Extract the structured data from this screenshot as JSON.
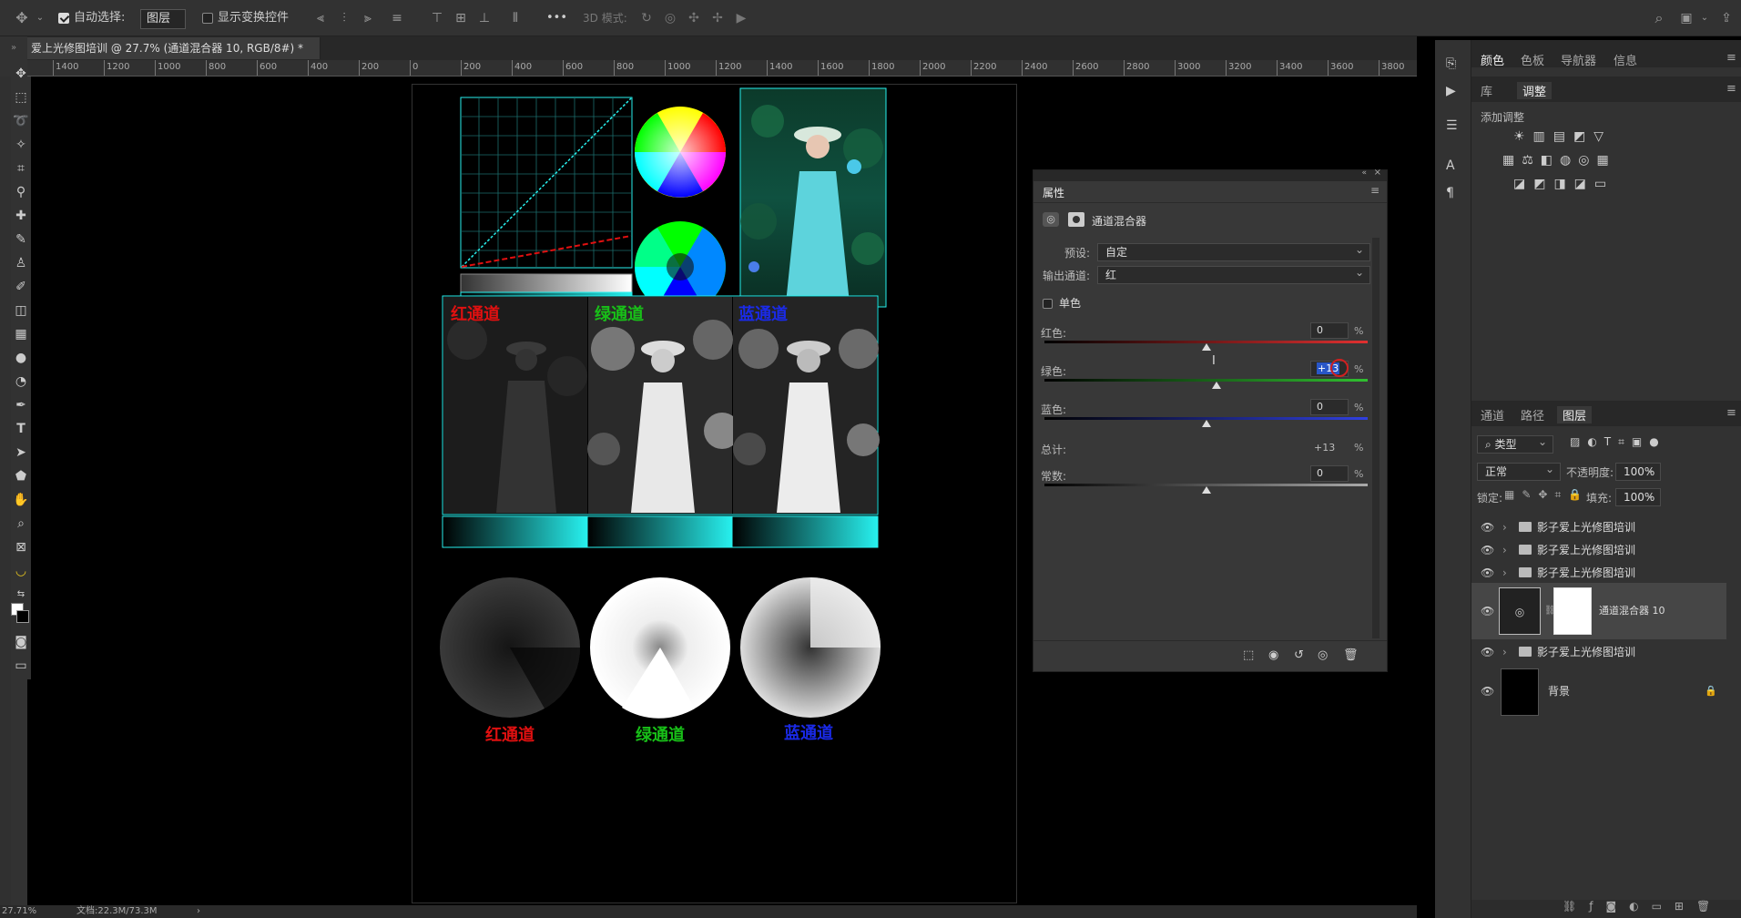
{
  "options_bar": {
    "auto_select_label": "自动选择:",
    "auto_select_value": "图层",
    "show_transform_label": "显示变换控件",
    "mode_3d_label": "3D 模式:",
    "more_label": "•••"
  },
  "document": {
    "tab_title": "爱上光修图培训 @ 27.7% (通道混合器 10, RGB/8#) *",
    "zoom": "27.71%",
    "doc_size": "文档:22.3M/73.3M"
  },
  "ruler": {
    "ticks": [
      "1400",
      "1200",
      "1000",
      "800",
      "600",
      "400",
      "200",
      "0",
      "200",
      "400",
      "600",
      "800",
      "1000",
      "1200",
      "1400",
      "1600",
      "1800",
      "2000",
      "2200",
      "2400",
      "2600",
      "2800",
      "3000",
      "3200",
      "3400",
      "3600",
      "3800"
    ]
  },
  "canvas": {
    "channel_labels": [
      "红通道",
      "绿通道",
      "蓝通道"
    ],
    "bottom_labels": [
      "红通道",
      "绿通道",
      "蓝通道"
    ],
    "colors": {
      "red": "#e01010",
      "green": "#18c018",
      "blue": "#1a2ae8",
      "cyan": "#27f0ee"
    }
  },
  "properties": {
    "panel_title": "属性",
    "adjustment_name": "通道混合器",
    "preset_label": "预设:",
    "preset_value": "自定",
    "output_label": "输出通道:",
    "output_value": "红",
    "mono_label": "单色",
    "red_label": "红色:",
    "red_value": "0",
    "green_label": "绿色:",
    "green_value": "+13",
    "blue_label": "蓝色:",
    "blue_value": "0",
    "total_label": "总计:",
    "total_value": "+13",
    "constant_label": "常数:",
    "constant_value": "0",
    "percent": "%"
  },
  "right_panel": {
    "top_tabs": [
      "颜色",
      "色板",
      "导航器",
      "信息"
    ],
    "second_tabs": [
      "库",
      "调整"
    ],
    "add_adjustment": "添加调整",
    "layer_tabs": [
      "通道",
      "路径",
      "图层"
    ],
    "filter_type": "类型",
    "blend_mode": "正常",
    "opacity_label": "不透明度:",
    "opacity_value": "100%",
    "lock_label": "锁定:",
    "fill_label": "填充:",
    "fill_value": "100%",
    "layers": [
      {
        "name": "影子爱上光修图培训",
        "kind": "group"
      },
      {
        "name": "影子爱上光修图培训",
        "kind": "group"
      },
      {
        "name": "影子爱上光修图培训",
        "kind": "group"
      },
      {
        "name": "通道混合器 10",
        "kind": "adjustment"
      },
      {
        "name": "影子爱上光修图培训",
        "kind": "group"
      },
      {
        "name": "背景",
        "kind": "background"
      }
    ]
  }
}
